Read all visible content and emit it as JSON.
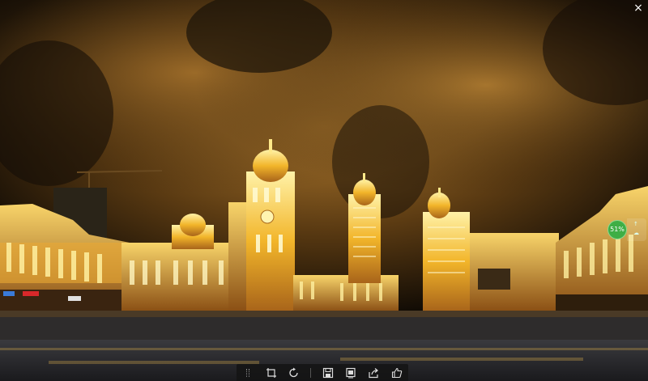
{
  "viewer": {
    "close_glyph": "×",
    "progress_text": "51%",
    "toolbar": {
      "icons": [
        "crop-icon",
        "rotate-icon",
        "save-icon",
        "copy-icon",
        "share-icon",
        "like-icon"
      ]
    }
  },
  "colors": {
    "sky": "#1c1408",
    "cloud_glow": "#8a5a1e",
    "building_light": "#f5c542",
    "ground": "#2a2a2e",
    "accent_green": "#3fae45"
  }
}
